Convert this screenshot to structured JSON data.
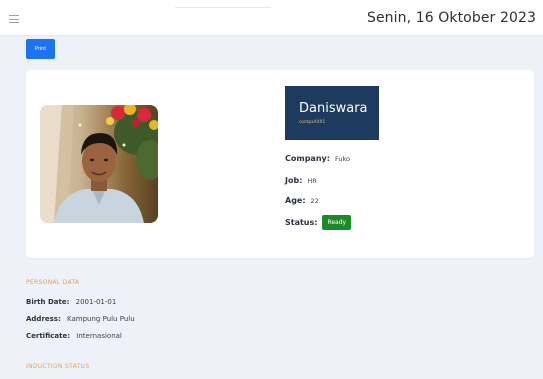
{
  "header": {
    "date": "Senin, 16 Oktober 2023",
    "menu_icon": "hamburger-icon"
  },
  "toolbar": {
    "print_label": "Print"
  },
  "profile": {
    "name": "Daniswara",
    "subtitle": "contpxXXX1",
    "company_label": "Company:",
    "company": "Fuko",
    "job_label": "Job:",
    "job": "HR",
    "age_label": "Age:",
    "age": "22",
    "status_label": "Status:",
    "status": "Ready",
    "status_color": "#1d8a2a",
    "namecard_color": "#1d3a5f"
  },
  "personal_data": {
    "title": "PERSONAL DATA",
    "birth_date_label": "Birth Date:",
    "birth_date": "2001-01-01",
    "address_label": "Address:",
    "address": "Kampung Pulu Pulu",
    "certificate_label": "Certificate:",
    "certificate": "Internasional"
  },
  "induction": {
    "title": "INDUCTION STATUS"
  },
  "colors": {
    "accent": "#1c73f0",
    "section_title": "#e0a15a",
    "background": "#eef2f8"
  }
}
